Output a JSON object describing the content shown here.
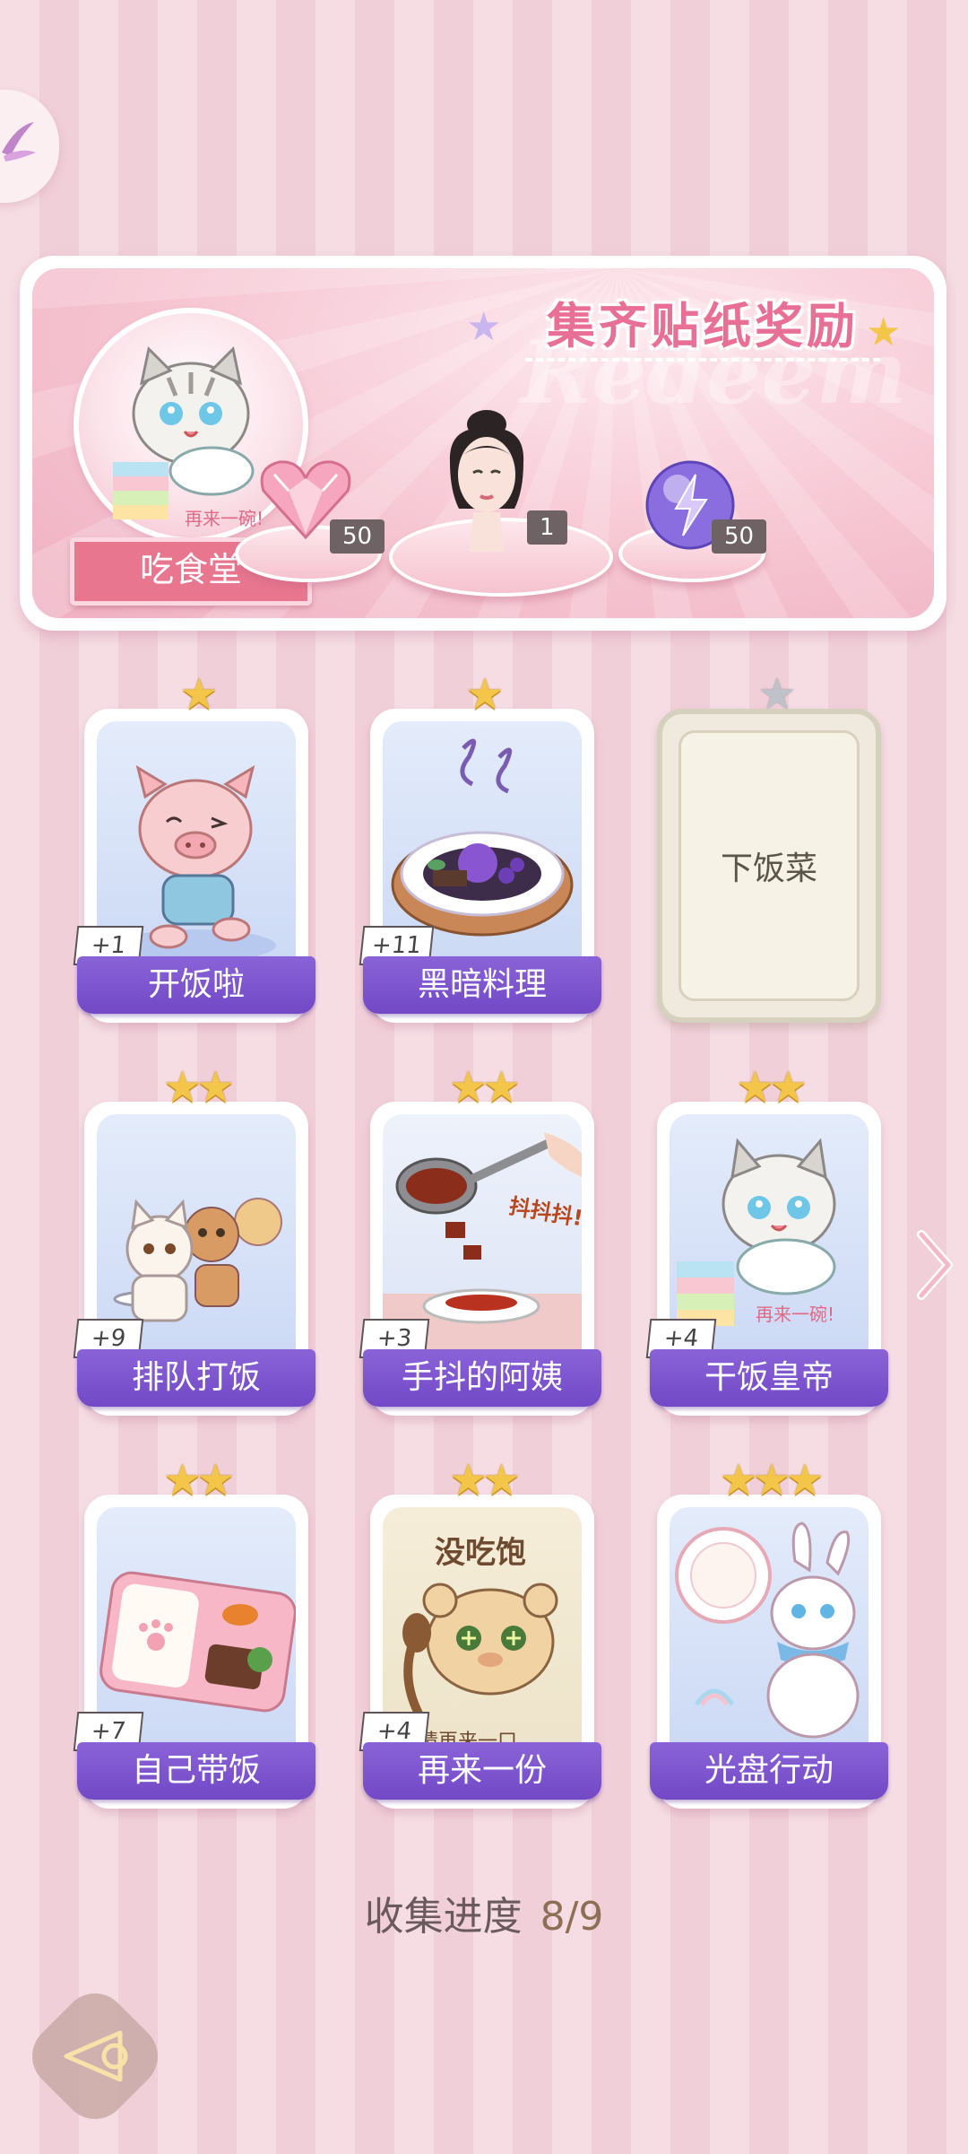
{
  "banner": {
    "title": "集齐贴纸奖励",
    "watermark": "Redeem",
    "cafe_label": "吃食堂",
    "cafe_caption": "再来一碗!",
    "rewards": [
      {
        "item": "pink-diamond",
        "count": "50"
      },
      {
        "item": "portrait-avatar",
        "count": "1"
      },
      {
        "item": "energy-orb",
        "count": "50"
      }
    ]
  },
  "cards": [
    {
      "label": "开饭啦",
      "badge": "+1",
      "stars": 1,
      "art": "running-pig"
    },
    {
      "label": "黑暗料理",
      "badge": "+11",
      "stars": 1,
      "art": "dark-cuisine-plate"
    },
    {
      "label": "下饭菜",
      "badge": "",
      "stars": 1,
      "locked": true
    },
    {
      "label": "排队打饭",
      "badge": "+9",
      "stars": 2,
      "art": "queue-animals"
    },
    {
      "label": "手抖的阿姨",
      "badge": "+3",
      "stars": 2,
      "art": "ladle-serving",
      "caption": "抖抖抖!"
    },
    {
      "label": "干饭皇帝",
      "badge": "+4",
      "stars": 2,
      "art": "cat-eating",
      "caption": "再来一碗!"
    },
    {
      "label": "自己带饭",
      "badge": "+7",
      "stars": 2,
      "art": "bento-box"
    },
    {
      "label": "再来一份",
      "badge": "+4",
      "stars": 2,
      "art": "hungry-hamster",
      "caption_top": "没吃饱",
      "caption_bottom": "请再来一口"
    },
    {
      "label": "光盘行动",
      "badge": "",
      "stars": 3,
      "art": "bunny-plate"
    }
  ],
  "progress": {
    "label": "收集进度",
    "value": "8/9"
  },
  "colors": {
    "accent": "#7a50cc",
    "pink": "#e9768f",
    "star": "#f3c64a"
  }
}
